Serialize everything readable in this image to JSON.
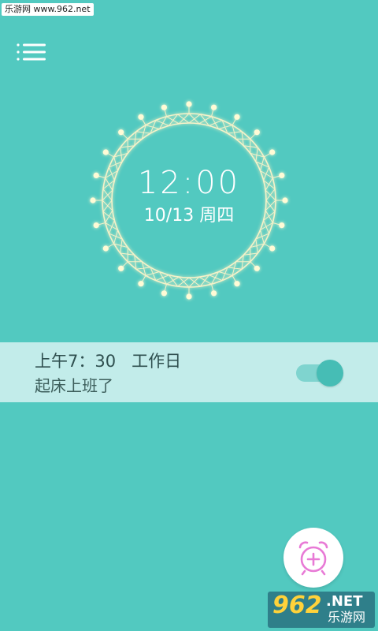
{
  "watermark": {
    "top_text": "乐游网 www.962.net",
    "bottom_big": "962",
    "bottom_net": ".NET",
    "bottom_cn": "乐游网"
  },
  "header": {
    "menu_icon": "menu-icon"
  },
  "clock": {
    "time": "12:00",
    "date": "10/13 周四",
    "ring_icon": "decorative-light-ring"
  },
  "alarms": [
    {
      "time_and_repeat": "上午7：30   工作日",
      "label": "起床上班了",
      "enabled": true
    }
  ],
  "fab": {
    "icon": "add-alarm-clock-icon"
  },
  "colors": {
    "background": "#52c9c0",
    "card": "#c2ecea",
    "toggle_on": "#46bdb5",
    "fab_icon": "#e87ad6",
    "ring": "#f6f2c8"
  }
}
